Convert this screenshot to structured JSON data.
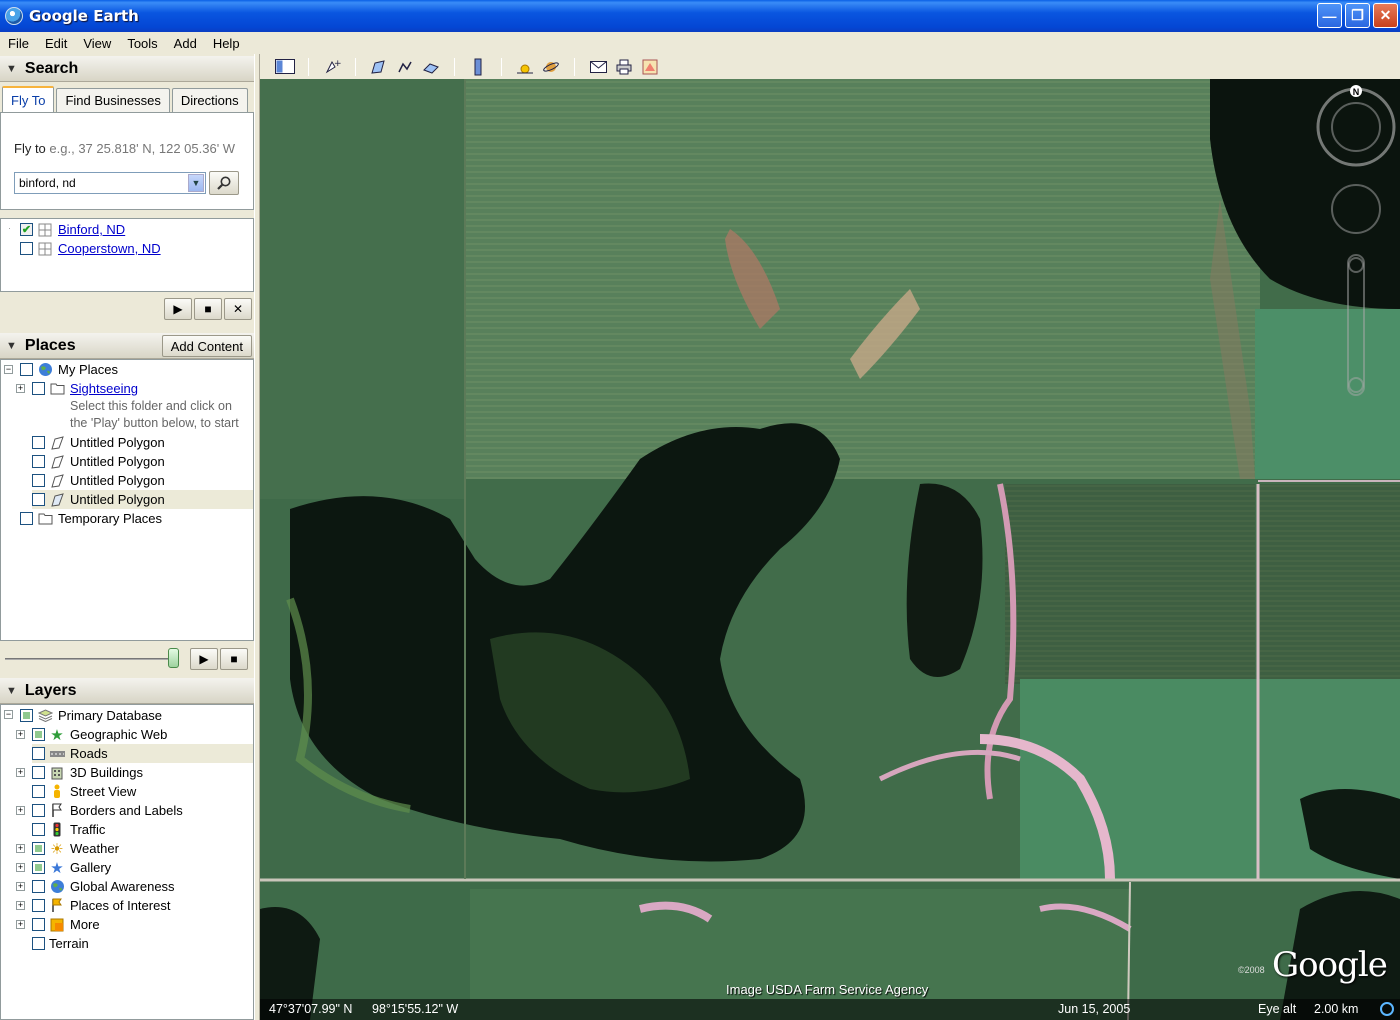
{
  "window": {
    "title": "Google Earth"
  },
  "menu": [
    "File",
    "Edit",
    "View",
    "Tools",
    "Add",
    "Help"
  ],
  "search": {
    "header": "Search",
    "tabs": [
      "Fly To",
      "Find Businesses",
      "Directions"
    ],
    "active_tab": "Fly To",
    "flyto_label": "Fly to",
    "flyto_hint": "e.g., 37 25.818' N, 122 05.36' W",
    "query": "binford, nd",
    "results": [
      {
        "label": "Binford, ND",
        "checked": true
      },
      {
        "label": "Cooperstown, ND",
        "checked": false
      }
    ]
  },
  "places": {
    "header": "Places",
    "add_content": "Add Content",
    "items": {
      "my_places": "My Places",
      "sightseeing": "Sightseeing",
      "sightseeing_desc_1": "Select this folder and click on",
      "sightseeing_desc_2": "the 'Play' button below, to start",
      "polygon_1": "Untitled Polygon",
      "polygon_2": "Untitled Polygon",
      "polygon_3": "Untitled Polygon",
      "polygon_4": "Untitled Polygon",
      "temporary": "Temporary Places"
    }
  },
  "layers": {
    "header": "Layers",
    "items": {
      "primary": "Primary Database",
      "geographic_web": "Geographic Web",
      "roads": "Roads",
      "buildings": "3D Buildings",
      "street_view": "Street View",
      "borders": "Borders and Labels",
      "traffic": "Traffic",
      "weather": "Weather",
      "gallery": "Gallery",
      "global_awareness": "Global Awareness",
      "poi": "Places of Interest",
      "more": "More",
      "terrain": "Terrain"
    }
  },
  "map": {
    "attribution": "Image USDA Farm Service Agency",
    "latitude": "47°37'07.99\" N",
    "longitude": "98°15'55.12\" W",
    "imagery_date": "Jun 15, 2005",
    "eye_alt_label": "Eye alt",
    "eye_alt_value": "2.00 km",
    "copyright": "©2008",
    "logo": "Google",
    "north_label": "N"
  },
  "colors": {
    "titlebar": "#0a56e0",
    "link": "#0000cc",
    "tab_accent": "#f7b33c"
  }
}
